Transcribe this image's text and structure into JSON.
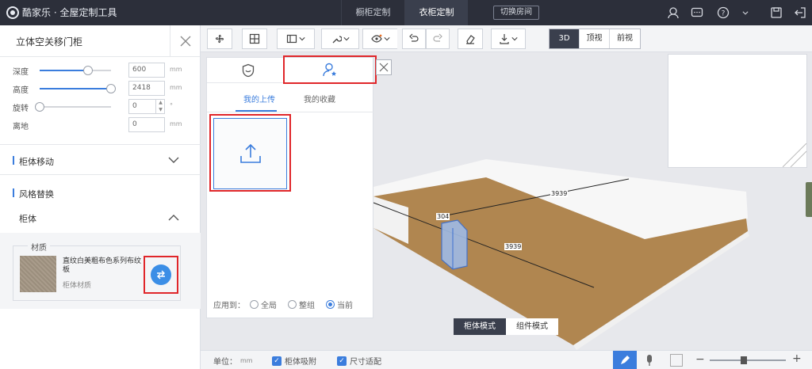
{
  "app": {
    "title": "酷家乐 · 全屋定制工具"
  },
  "top_tabs": [
    {
      "label": "橱柜定制"
    },
    {
      "label": "衣柜定制"
    }
  ],
  "switch_room_label": "切换房间",
  "left_panel": {
    "title": "立体空关移门柜",
    "params": [
      {
        "label": "深度",
        "value": "600",
        "unit": "mm",
        "level": 0.68
      },
      {
        "label": "高度",
        "value": "2418",
        "unit": "mm",
        "level": 1.0
      },
      {
        "label": "旋转",
        "value": "0",
        "unit": "°",
        "level": 0.0
      },
      {
        "label": "离地",
        "value": "0",
        "unit": "mm"
      }
    ],
    "sections": {
      "custom_move": "柜体移动",
      "style_replace": "风格替换",
      "cabinet": "柜体"
    },
    "material": {
      "legend": "材质",
      "name": "直纹白美粗布色系列布纹板",
      "sub": "柜体材质"
    }
  },
  "toolbar": {
    "view_modes": [
      {
        "label": "3D",
        "active": true
      },
      {
        "label": "顶视",
        "active": false
      },
      {
        "label": "前视",
        "active": false
      }
    ]
  },
  "library": {
    "sub_tabs": {
      "uploads": "我的上传",
      "favorites": "我的收藏"
    },
    "apply_to": {
      "label": "应用到：",
      "options": [
        {
          "label": "全局",
          "selected": false
        },
        {
          "label": "整组",
          "selected": false
        },
        {
          "label": "当前",
          "selected": true
        }
      ]
    }
  },
  "scene": {
    "dimensions": {
      "top": "3939",
      "left": "304",
      "mid": "3939"
    }
  },
  "mode_buttons": {
    "cabinet_mode": "柜体模式",
    "door_mode": "组件模式"
  },
  "bottom_bar": {
    "unit_label": "单位：",
    "unit_value": "mm",
    "snap_label": "柜体吸附",
    "size_label": "尺寸适配",
    "zoom_level": 0.45
  },
  "colors": {
    "accent": "#3b7ddd",
    "highlight": "#e0262a",
    "dark": "#2c2f3a",
    "floor": "#b08650"
  }
}
